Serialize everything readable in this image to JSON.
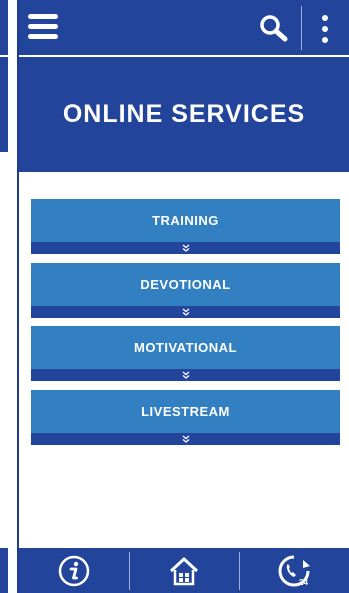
{
  "hero": {
    "title": "ONLINE SERVICES"
  },
  "services": [
    {
      "label": "TRAINING"
    },
    {
      "label": "DEVOTIONAL"
    },
    {
      "label": "MOTIVATIONAL"
    },
    {
      "label": "LIVESTREAM"
    }
  ],
  "bottom_bar": {
    "items": [
      {
        "icon": "info-icon"
      },
      {
        "icon": "home-icon"
      },
      {
        "icon": "support-24-icon",
        "badge": "24"
      }
    ]
  },
  "colors": {
    "primary": "#23449b",
    "service_button": "#3280c2",
    "background": "#ffffff"
  }
}
